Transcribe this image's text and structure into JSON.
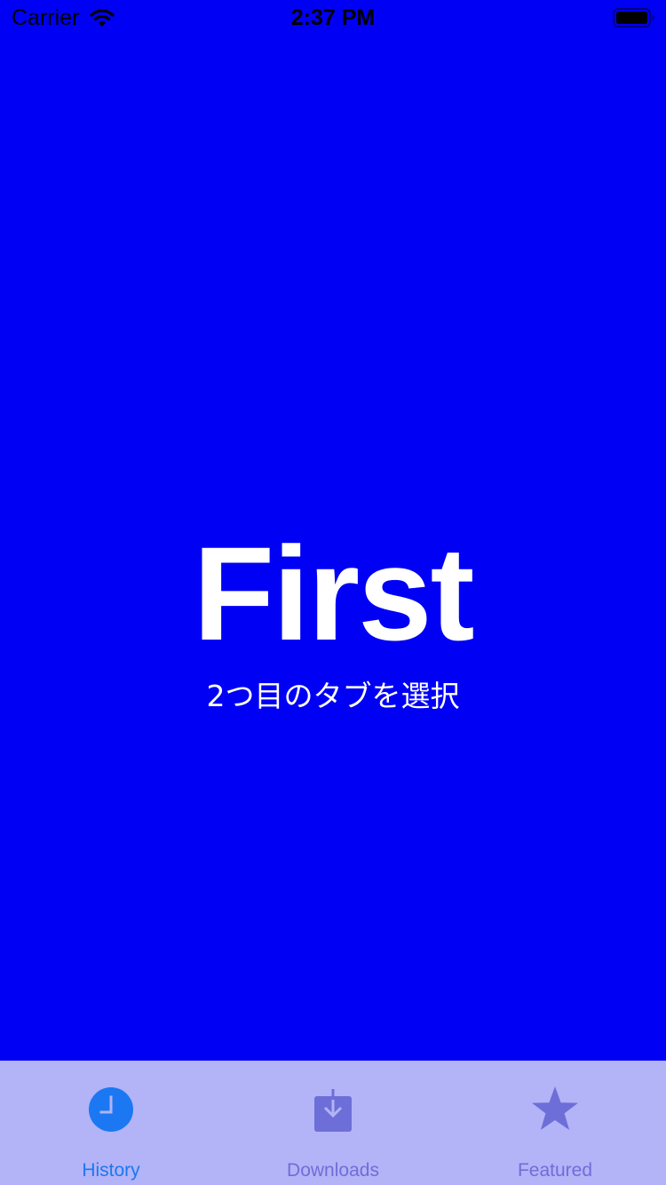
{
  "status_bar": {
    "carrier": "Carrier",
    "time": "2:37 PM",
    "wifi_icon": "wifi-icon",
    "battery_icon": "battery-full-icon"
  },
  "content": {
    "title": "First",
    "subtitle": "2つ目のタブを選択",
    "background_color": "#0000f5",
    "text_color": "#ffffff"
  },
  "tab_bar": {
    "background_color": "#b3b3f7",
    "active_color": "#1b78f2",
    "inactive_color": "#6e6ed8",
    "tabs": [
      {
        "label": "History",
        "icon": "clock-icon",
        "active": true
      },
      {
        "label": "Downloads",
        "icon": "download-icon",
        "active": false
      },
      {
        "label": "Featured",
        "icon": "star-icon",
        "active": false
      }
    ]
  }
}
